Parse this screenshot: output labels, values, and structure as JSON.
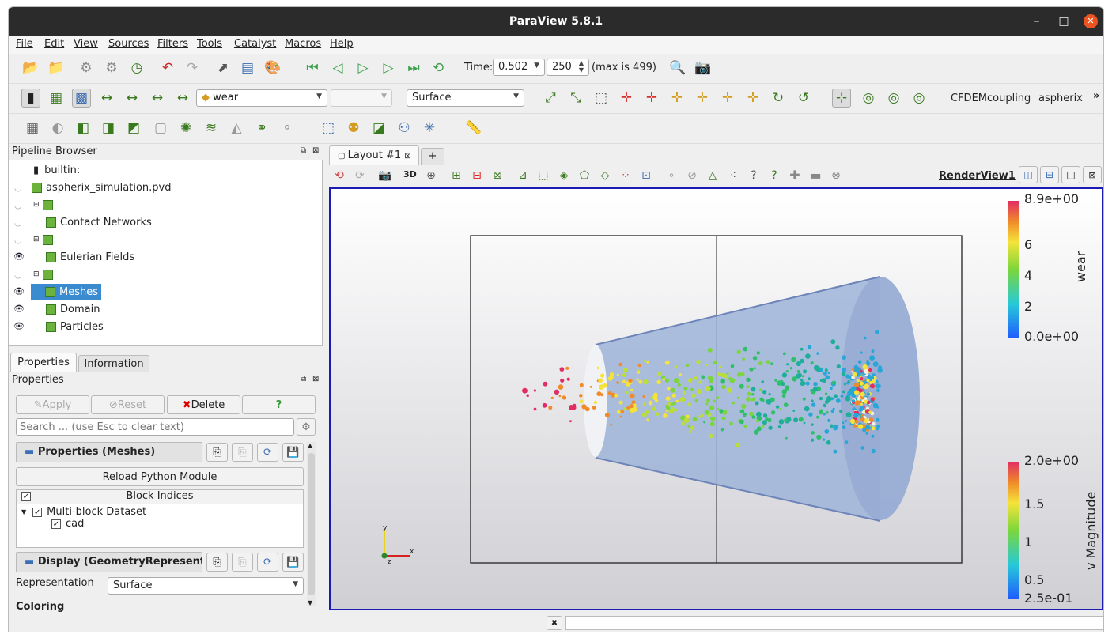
{
  "window": {
    "title": "ParaView 5.8.1"
  },
  "window_controls": {
    "minimize": "–",
    "maximize": "□",
    "close": "✕"
  },
  "menu": [
    "File",
    "Edit",
    "View",
    "Sources",
    "Filters",
    "Tools",
    "Catalyst",
    "Macros",
    "Help"
  ],
  "time_toolbar": {
    "time_label": "Time:",
    "time_value": "0.502",
    "step_value": "250",
    "max_text": "(max is 499)"
  },
  "colors_toolbar": {
    "array_value": "wear",
    "component_value": "",
    "representation_value": "Surface"
  },
  "custom_toolbar": {
    "item1": "CFDEMcoupling",
    "item2": "aspherix",
    "more": "»"
  },
  "pipeline": {
    "header": "Pipeline Browser",
    "items": [
      {
        "label": "builtin:"
      },
      {
        "label": "aspherix_simulation.pvd"
      },
      {
        "label": ""
      },
      {
        "label": "Contact Networks"
      },
      {
        "label": ""
      },
      {
        "label": "Eulerian Fields"
      },
      {
        "label": ""
      },
      {
        "label": "Meshes"
      },
      {
        "label": "Domain"
      },
      {
        "label": "Particles"
      }
    ]
  },
  "prop_tabs": {
    "properties": "Properties",
    "information": "Information"
  },
  "properties": {
    "header": "Properties",
    "apply": "Apply",
    "reset": "Reset",
    "delete": "Delete",
    "help": "?",
    "search_placeholder": "Search ... (use Esc to clear text)",
    "section_meshes": "Properties (Meshes)",
    "reload": "Reload Python Module",
    "block_indices": "Block Indices",
    "multiblock": "Multi-block Dataset",
    "cad": "cad",
    "section_display": "Display (GeometryRepresent",
    "representation_label": "Representation",
    "representation_value": "Surface",
    "coloring": "Coloring"
  },
  "layout": {
    "tab": "Layout #1",
    "add": "+",
    "view_name": "RenderView1",
    "mode_3d": "3D"
  },
  "colorbar_wear": {
    "title": "wear",
    "max": "8.9e+00",
    "min": "0.0e+00",
    "ticks": [
      "6",
      "4",
      "2"
    ]
  },
  "colorbar_v": {
    "title": "v Magnitude",
    "max": "2.0e+00",
    "min": "2.5e-01",
    "ticks": [
      "1.5",
      "1",
      "0.5"
    ]
  },
  "axes": {
    "x": "x",
    "y": "y",
    "z": "z"
  },
  "colors": {
    "titlebar": "#2b2b2b",
    "close": "#e95420",
    "selection": "#3b8bd0",
    "view_border": "#1b1bb3"
  }
}
